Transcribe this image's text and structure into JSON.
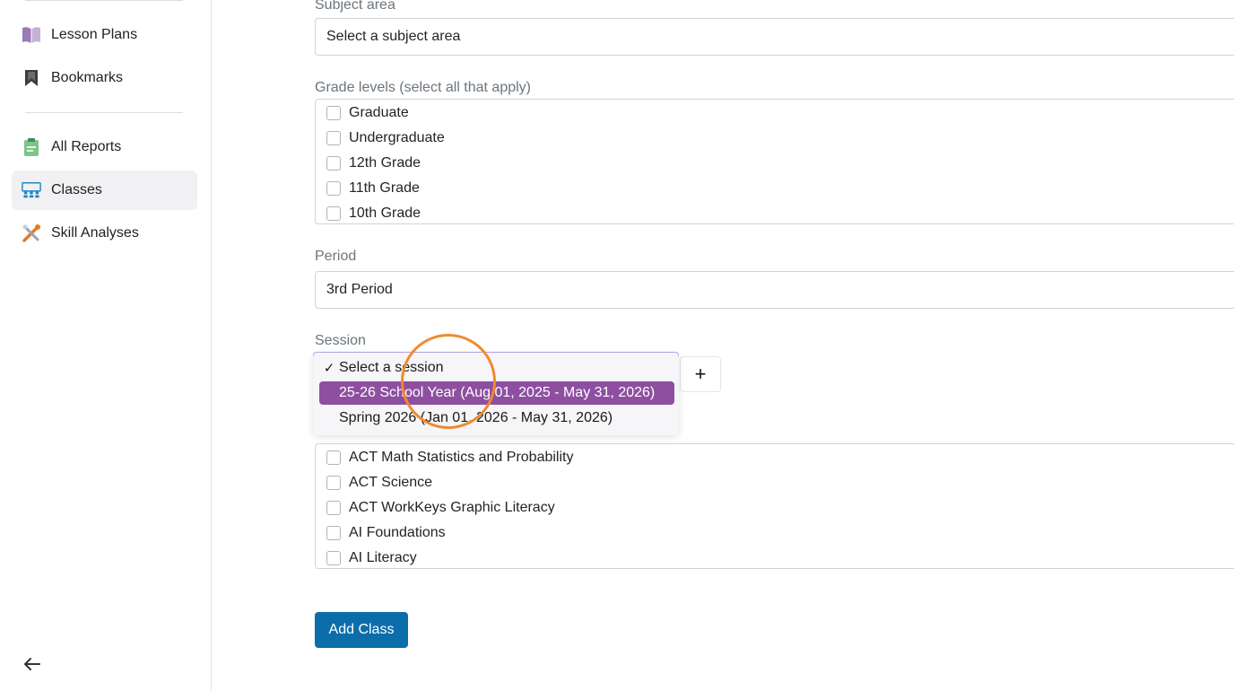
{
  "sidebar": {
    "items": [
      {
        "label": "Lesson Plans",
        "icon": "book-icon"
      },
      {
        "label": "Bookmarks",
        "icon": "bookmark-icon"
      },
      {
        "label": "All Reports",
        "icon": "clipboard-icon"
      },
      {
        "label": "Classes",
        "icon": "classroom-icon",
        "active": true
      },
      {
        "label": "Skill Analyses",
        "icon": "tools-icon"
      }
    ],
    "collapse_icon": "arrow-left-icon"
  },
  "form": {
    "subject": {
      "label": "Subject area",
      "value": "Select a subject area"
    },
    "grades": {
      "label": "Grade levels (select all that apply)",
      "options": [
        "Graduate",
        "Undergraduate",
        "12th Grade",
        "11th Grade",
        "10th Grade"
      ]
    },
    "period": {
      "label": "Period",
      "value": "3rd Period"
    },
    "session": {
      "label": "Session",
      "options": [
        {
          "label": "Select a session",
          "checked": true
        },
        {
          "label": "25-26 School Year (Aug 01, 2025 - May 31, 2026)",
          "highlighted": true
        },
        {
          "label": "Spring 2026 (Jan 01, 2026 - May 31, 2026)"
        }
      ],
      "add_label": "+"
    },
    "learning_paths": {
      "options": [
        "ACT Math Statistics and Probability",
        "ACT Science",
        "ACT WorkKeys Graphic Literacy",
        "AI Foundations",
        "AI Literacy"
      ]
    },
    "submit_label": "Add Class"
  },
  "colors": {
    "primary_button": "#0b6eab",
    "highlight": "#8e4fa0",
    "cursor_ring": "#f08a2e"
  }
}
